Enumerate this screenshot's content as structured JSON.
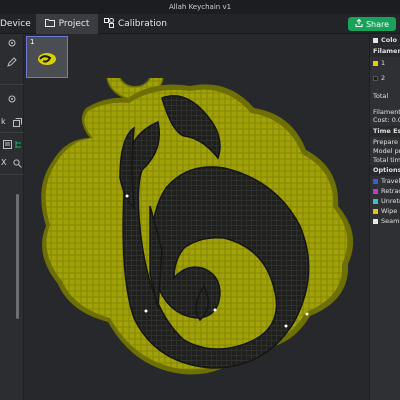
{
  "window": {
    "title": "Allah Keychain v1"
  },
  "tabs": [
    {
      "label": "Device"
    },
    {
      "label": "Project"
    },
    {
      "label": "Calibration"
    }
  ],
  "share": {
    "label": "Share"
  },
  "left_panel": {
    "label_k": "k",
    "label_x": "X"
  },
  "plate": {
    "number": "1"
  },
  "right_panel": {
    "header": "Colo",
    "filament_label": "Filament",
    "filaments": [
      {
        "label": "1",
        "color": "#d6d300"
      },
      {
        "label": "2",
        "color": "#1c1c1c"
      }
    ],
    "total": "Total",
    "filament_cost_1": "Filament",
    "filament_cost_2": "Cost: 0.0",
    "time_title": "Time Esti",
    "time_rows": [
      "Prepare ti",
      "Model pri",
      "Total time"
    ],
    "options_title": "Options",
    "options": [
      {
        "label": "Travel",
        "color": "#3b5bd6"
      },
      {
        "label": "Retract",
        "color": "#c43cc4"
      },
      {
        "label": "Unretra",
        "color": "#3cc4c4"
      },
      {
        "label": "Wipe",
        "color": "#e8c218"
      },
      {
        "label": "Seams",
        "color": "#e8e8e8"
      }
    ]
  },
  "model_colors": {
    "body": "#9a9c06",
    "body_light": "#b9bb10",
    "edge": "#6e7004",
    "calligraphy": "#1e1f1d"
  },
  "ui_colors": {
    "accent_green": "#17a35a",
    "selection_blue": "#6c7ad6"
  }
}
